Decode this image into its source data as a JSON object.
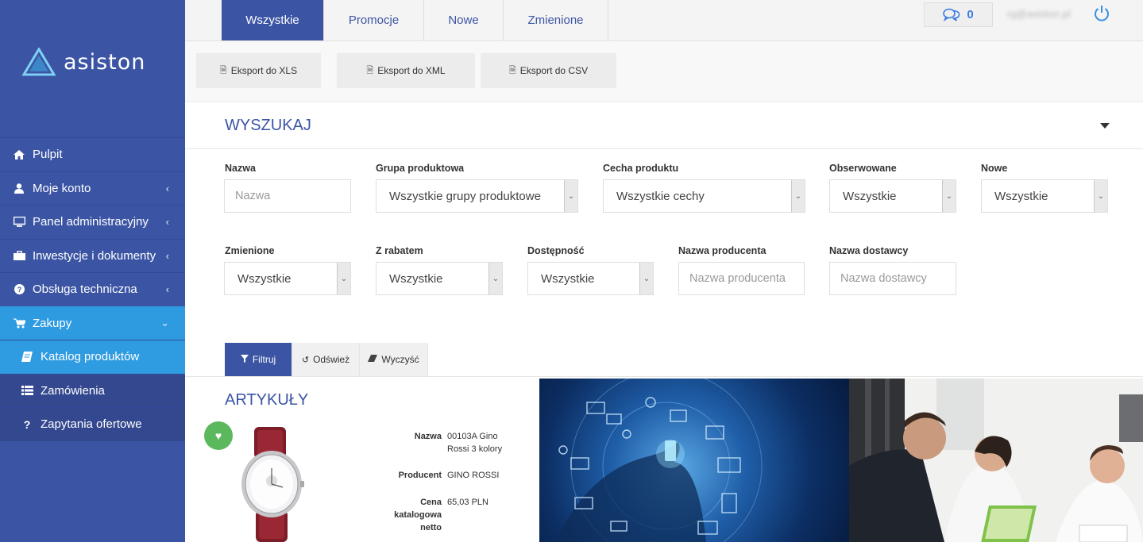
{
  "brand": {
    "name": "asiston"
  },
  "sidebar": {
    "items": [
      {
        "label": "Pulpit",
        "icon": "home-icon"
      },
      {
        "label": "Moje konto",
        "icon": "user-icon",
        "has_submenu": true
      },
      {
        "label": "Panel administracyjny",
        "icon": "monitor-icon",
        "has_submenu": true
      },
      {
        "label": "Inwestycje i dokumenty",
        "icon": "briefcase-icon",
        "has_submenu": true
      },
      {
        "label": "Obsługa techniczna",
        "icon": "help-icon",
        "has_submenu": true
      },
      {
        "label": "Zakupy",
        "icon": "cart-icon",
        "expanded": true
      },
      {
        "label": "Katalog produktów",
        "icon": "book-icon",
        "selected": true
      },
      {
        "label": "Zamówienia",
        "icon": "list-icon"
      },
      {
        "label": "Zapytania ofertowe",
        "icon": "question-icon"
      }
    ]
  },
  "topbar": {
    "tabs": [
      "Wszystkie",
      "Promocje",
      "Nowe",
      "Zmienione"
    ],
    "active_tab": "Wszystkie",
    "messages_count": "0",
    "user_email": "rg@asiston.pl"
  },
  "export": {
    "xls": "Eksport do XLS",
    "xml": "Eksport do XML",
    "csv": "Eksport do CSV"
  },
  "search": {
    "title": "WYSZUKAJ",
    "fields": {
      "nazwa": {
        "label": "Nazwa",
        "placeholder": "Nazwa"
      },
      "grupa": {
        "label": "Grupa produktowa",
        "value": "Wszystkie grupy produktowe"
      },
      "cecha": {
        "label": "Cecha produktu",
        "value": "Wszystkie cechy"
      },
      "obserwowane": {
        "label": "Obserwowane",
        "value": "Wszystkie"
      },
      "nowe": {
        "label": "Nowe",
        "value": "Wszystkie"
      },
      "zmienione": {
        "label": "Zmienione",
        "value": "Wszystkie"
      },
      "rabat": {
        "label": "Z rabatem",
        "value": "Wszystkie"
      },
      "dostepnosc": {
        "label": "Dostępność",
        "value": "Wszystkie"
      },
      "producent": {
        "label": "Nazwa producenta",
        "placeholder": "Nazwa producenta"
      },
      "dostawca": {
        "label": "Nazwa dostawcy",
        "placeholder": "Nazwa dostawcy"
      }
    },
    "buttons": {
      "filter": "Filtruj",
      "refresh": "Odśwież",
      "clear": "Wyczyść"
    }
  },
  "articles": {
    "title": "ARTYKUŁY",
    "item": {
      "name_label": "Nazwa",
      "name_value": "00103A Gino Rossi 3 kolory",
      "producer_label": "Producent",
      "producer_value": "GINO ROSSI",
      "price_label": "Cena katalogowa netto",
      "price_value": "65,03 PLN"
    }
  },
  "colors": {
    "primary": "#3b55a4",
    "accent": "#2e9be0",
    "favorite": "#5cb85c"
  }
}
